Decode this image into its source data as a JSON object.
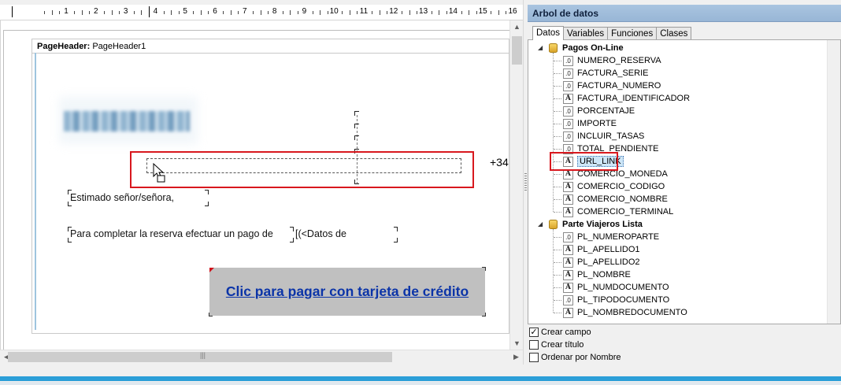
{
  "ruler": {
    "numbers": [
      "1",
      "2",
      "3",
      "4",
      "5",
      "6",
      "7",
      "8",
      "9",
      "10",
      "11",
      "12",
      "13",
      "14",
      "15",
      "16"
    ]
  },
  "designer": {
    "band_header_label": "PageHeader:",
    "band_header_name": "PageHeader1",
    "phone_prefix": "+34",
    "greeting": "Estimado señor/señora,",
    "instruction": "Para completar la reserva efectuar un pago de",
    "data_field_text": "[(<Datos de",
    "pay_button_label": "Clic para pagar con tarjeta de crédito"
  },
  "panel": {
    "title": "Arbol de datos",
    "tabs": [
      {
        "label": "Datos",
        "active": true
      },
      {
        "label": "Variables",
        "active": false
      },
      {
        "label": "Funciones",
        "active": false
      },
      {
        "label": "Clases",
        "active": false
      }
    ],
    "groups": [
      {
        "label": "Pagos On-Line",
        "fields": [
          {
            "name": "NUMERO_RESERVA",
            "type": "num"
          },
          {
            "name": "FACTURA_SERIE",
            "type": "num"
          },
          {
            "name": "FACTURA_NUMERO",
            "type": "num"
          },
          {
            "name": "FACTURA_IDENTIFICADOR",
            "type": "text"
          },
          {
            "name": "PORCENTAJE",
            "type": "num"
          },
          {
            "name": "IMPORTE",
            "type": "num"
          },
          {
            "name": "INCLUIR_TASAS",
            "type": "num"
          },
          {
            "name": "TOTAL_PENDIENTE",
            "type": "num"
          },
          {
            "name": "URL_LINK",
            "type": "text",
            "selected": true
          },
          {
            "name": "COMERCIO_MONEDA",
            "type": "text"
          },
          {
            "name": "COMERCIO_CODIGO",
            "type": "text"
          },
          {
            "name": "COMERCIO_NOMBRE",
            "type": "text"
          },
          {
            "name": "COMERCIO_TERMINAL",
            "type": "text"
          }
        ]
      },
      {
        "label": "Parte Viajeros Lista",
        "fields": [
          {
            "name": "PL_NUMEROPARTE",
            "type": "num"
          },
          {
            "name": "PL_APELLIDO1",
            "type": "text"
          },
          {
            "name": "PL_APELLIDO2",
            "type": "text"
          },
          {
            "name": "PL_NOMBRE",
            "type": "text"
          },
          {
            "name": "PL_NUMDOCUMENTO",
            "type": "text"
          },
          {
            "name": "PL_TIPODOCUMENTO",
            "type": "num"
          },
          {
            "name": "PL_NOMBREDOCUMENTO",
            "type": "text"
          }
        ]
      }
    ],
    "options": [
      {
        "label": "Crear campo",
        "checked": true
      },
      {
        "label": "Crear título",
        "checked": false
      },
      {
        "label": "Ordenar por Nombre",
        "checked": false
      }
    ]
  },
  "icons": {
    "num_field_glyph": ".0",
    "text_field_glyph": "A",
    "check_glyph": "✓",
    "expander_glyph": "◢"
  },
  "colors": {
    "highlight_red": "#d8181e",
    "link_blue": "#0b34a8",
    "panel_title_bg": "#a9c4e0",
    "status_bar": "#2c9fd8"
  }
}
